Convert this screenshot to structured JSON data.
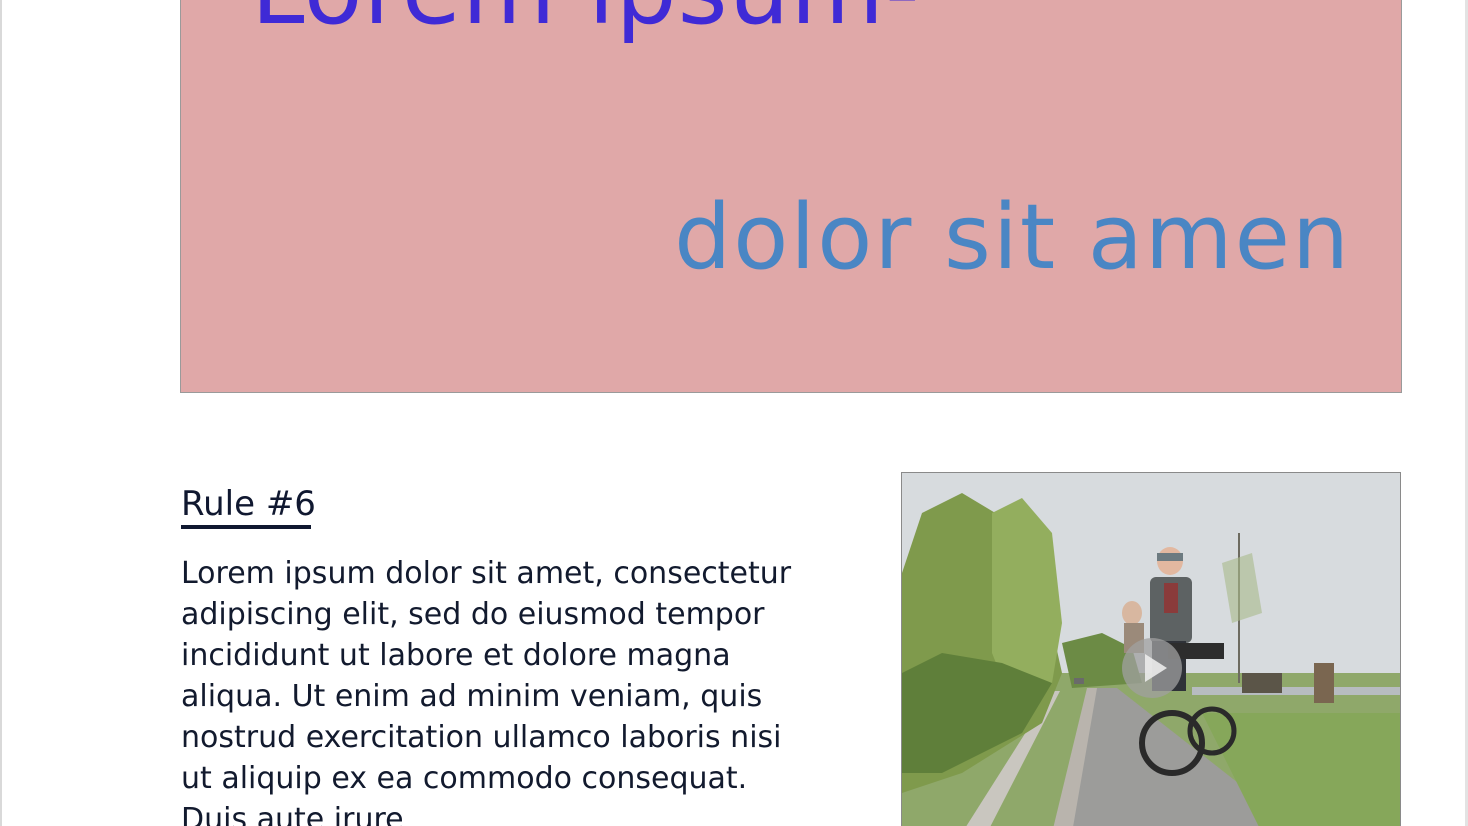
{
  "hero": {
    "title": "Lorem ipsum-",
    "subtitle": "dolor sit amen",
    "background": "#e0a8a8",
    "title_color": "#3f2ad6",
    "subtitle_color": "#4a86c4"
  },
  "rule": {
    "heading": "Rule #6",
    "body": "Lorem ipsum dolor sit amet, consectetur\nadipiscing elit, sed do eiusmod tempor\nincididunt ut labore et dolore magna\naliqua. Ut enim ad minim veniam, quis\nnostrud exercitation ullamco laboris nisi\nut aliquip ex ea commodo consequat.\nDuis aute irure"
  },
  "video": {
    "play_icon": "play-icon"
  }
}
